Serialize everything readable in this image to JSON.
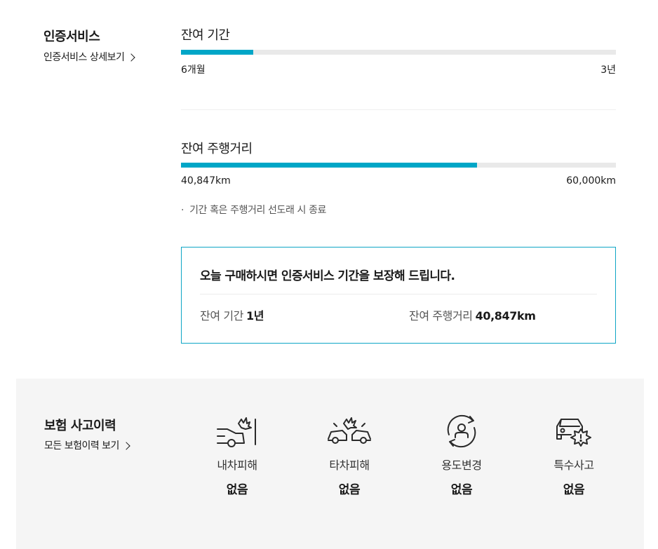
{
  "cert": {
    "title": "인증서비스",
    "detail_link": "인증서비스 상세보기",
    "period": {
      "label": "잔여 기간",
      "min": "6개월",
      "max": "3년",
      "progress": 0.166
    },
    "mileage": {
      "label": "잔여 주행거리",
      "min": "40,847km",
      "max": "60,000km",
      "progress": 0.681
    },
    "note": "기간 혹은 주행거리 선도래 시 종료",
    "note_bullet": "·",
    "promo": {
      "title": "오늘 구매하시면 인증서비스 기간을 보장해 드립니다.",
      "period_label": "잔여 기간",
      "period_value": "1년",
      "mileage_label": "잔여 주행거리",
      "mileage_value": "40,847km"
    }
  },
  "insurance": {
    "title": "보험 사고이력",
    "link": "모든 보험이력 보기",
    "items": [
      {
        "icon": "own-damage-icon",
        "label": "내차피해",
        "value": "없음"
      },
      {
        "icon": "other-damage-icon",
        "label": "타차피해",
        "value": "없음"
      },
      {
        "icon": "usage-change-icon",
        "label": "용도변경",
        "value": "없음"
      },
      {
        "icon": "special-accident-icon",
        "label": "특수사고",
        "value": "없음"
      }
    ]
  },
  "colors": {
    "accent": "#00a6c7",
    "track": "#e9e9e9",
    "panel": "#f5f5f5"
  }
}
